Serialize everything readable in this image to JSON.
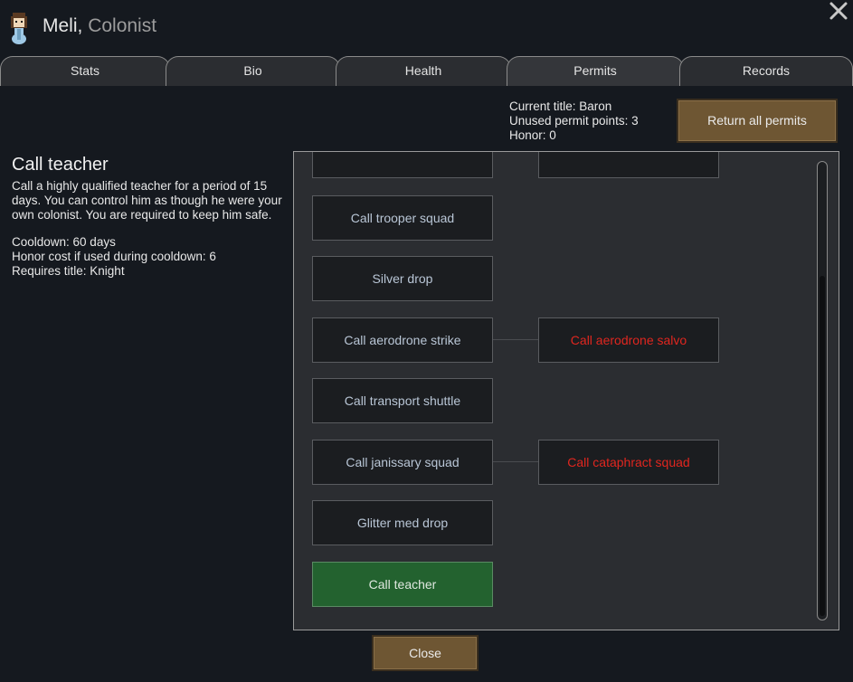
{
  "header": {
    "pawn_name": "Meli",
    "separator": ", ",
    "pawn_role": "Colonist"
  },
  "tabs": [
    "Stats",
    "Bio",
    "Health",
    "Permits",
    "Records"
  ],
  "title_info": {
    "current_title": "Current title: Baron",
    "unused_points": "Unused permit points: 3",
    "honor": "Honor: 0"
  },
  "buttons": {
    "return_all": "Return all permits",
    "close": "Close"
  },
  "detail": {
    "title": "Call teacher",
    "description": "Call a highly qualified teacher for a period of 15 days. You can control him as though he were your own colonist. You are required to keep him safe.",
    "cooldown": "Cooldown: 60 days",
    "honor_cost": "Honor cost if used during cooldown: 6",
    "requires": "Requires title: Knight"
  },
  "permits": {
    "left": [
      "",
      "Call trooper squad",
      "Silver drop",
      "Call aerodrone strike",
      "Call transport shuttle",
      "Call janissary squad",
      "Glitter med drop",
      "Call teacher"
    ],
    "right_aerodrone": "Call aerodrone salvo",
    "right_cataphract": "Call cataphract squad",
    "right_top": ""
  },
  "colors": {
    "locked": "#e0261f",
    "selected": "#23622f",
    "button": "#6e5633"
  }
}
